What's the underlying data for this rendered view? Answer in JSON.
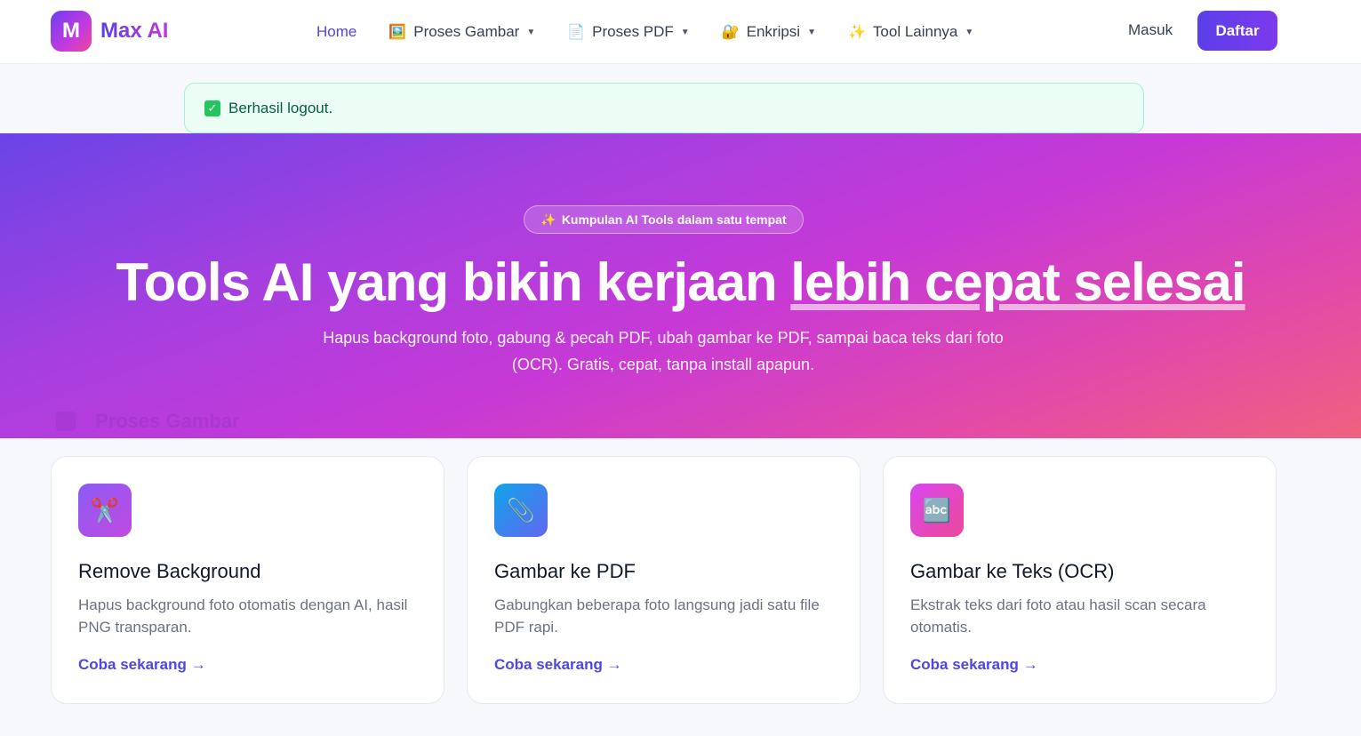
{
  "brand": {
    "logo_letter": "M",
    "name": "Max AI"
  },
  "nav": {
    "items": [
      {
        "label": "Home",
        "icon": "",
        "has_dropdown": false
      },
      {
        "label": "Proses Gambar",
        "icon": "🖼️",
        "has_dropdown": true
      },
      {
        "label": "Proses PDF",
        "icon": "📄",
        "has_dropdown": true
      },
      {
        "label": "Enkripsi",
        "icon": "🔐",
        "has_dropdown": true
      },
      {
        "label": "Tool Lainnya",
        "icon": "✨",
        "has_dropdown": true
      }
    ],
    "caret": "▼",
    "login_label": "Masuk",
    "register_label": "Daftar"
  },
  "alert": {
    "icon": "✓",
    "message": "Berhasil logout."
  },
  "hero": {
    "badge_icon": "✨",
    "badge": "Kumpulan AI Tools dalam satu tempat",
    "title_plain": "Tools AI yang bikin kerjaan ",
    "title_highlight": "lebih cepat selesai",
    "subtitle": "Hapus background foto, gabung & pecah PDF, ubah gambar ke PDF, sampai baca teks dari foto (OCR). Gratis, cepat, tanpa install apapun.",
    "section_label": "Proses Gambar"
  },
  "cards": [
    {
      "icon": "✂️",
      "icon_name": "scissors-icon",
      "title": "Remove Background",
      "desc": "Hapus background foto otomatis dengan AI, hasil PNG transparan.",
      "link": "Coba sekarang →"
    },
    {
      "icon": "📎",
      "icon_name": "paperclip-icon",
      "title": "Gambar ke PDF",
      "desc": "Gabungkan beberapa foto langsung jadi satu file PDF rapi.",
      "link": "Coba sekarang →"
    },
    {
      "icon": "🔤",
      "icon_name": "abc-icon",
      "title": "Gambar ke Teks (OCR)",
      "desc": "Ekstrak teks dari foto atau hasil scan secara otomatis.",
      "link": "Coba sekarang →"
    }
  ],
  "colors": {
    "accent": "#4f46e5",
    "card_icon_bg": [
      "#8b5cf6",
      "#3b82f6",
      "#ec4899"
    ]
  }
}
